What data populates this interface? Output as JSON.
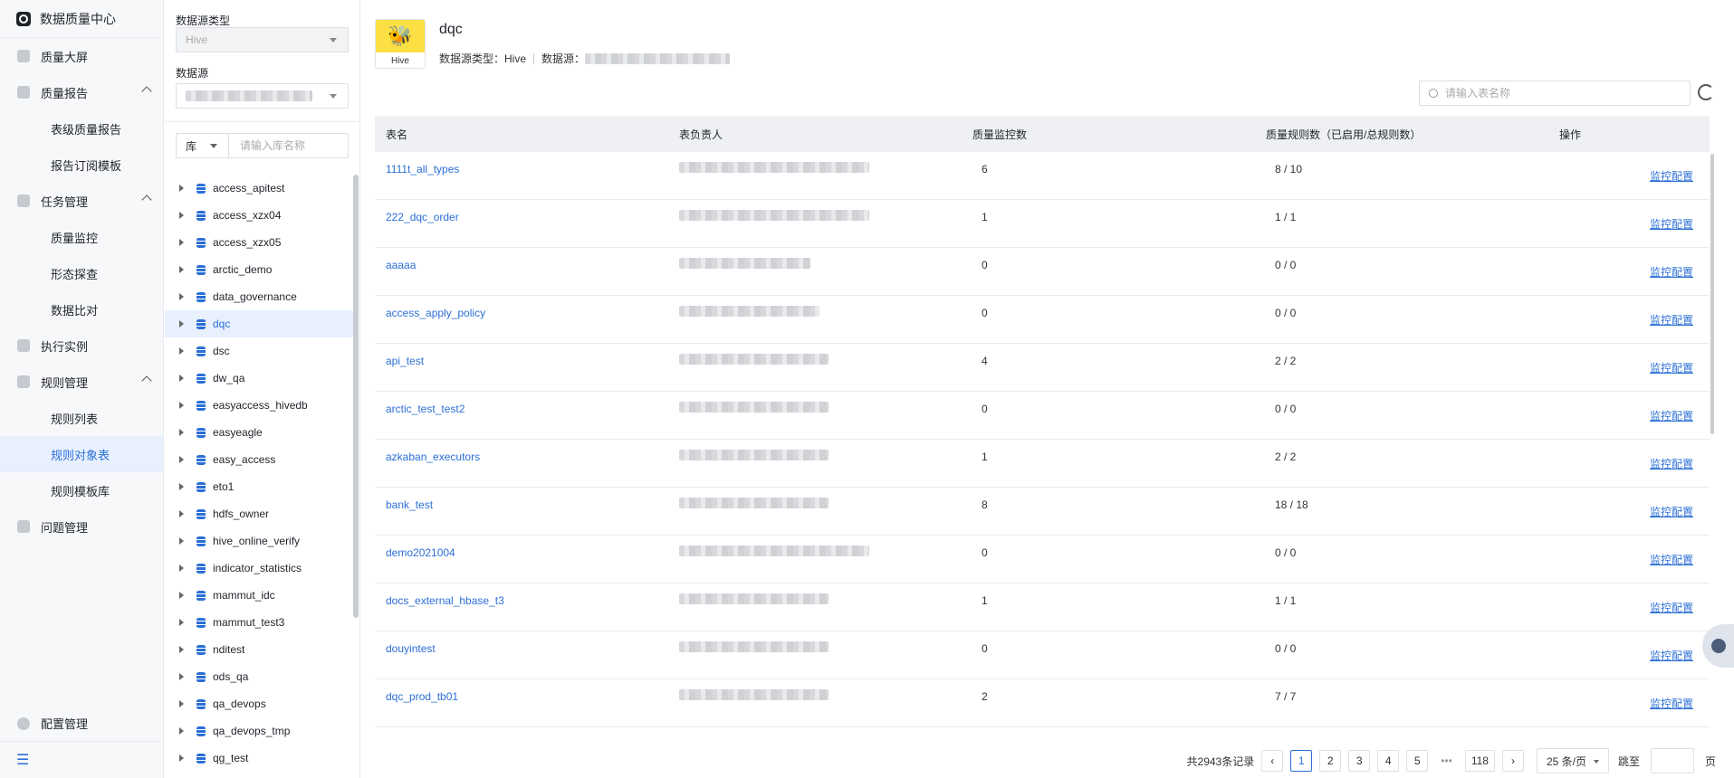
{
  "nav": {
    "title": "数据质量中心",
    "items": [
      {
        "label": "质量大屏",
        "icon": "dashboard-icon"
      },
      {
        "label": "质量报告",
        "icon": "report-icon",
        "expanded": true,
        "children": [
          {
            "label": "表级质量报告"
          },
          {
            "label": "报告订阅模板"
          }
        ]
      },
      {
        "label": "任务管理",
        "icon": "task-icon",
        "expanded": true,
        "children": [
          {
            "label": "质量监控"
          },
          {
            "label": "形态探查"
          },
          {
            "label": "数据比对"
          }
        ]
      },
      {
        "label": "执行实例",
        "icon": "instance-icon"
      },
      {
        "label": "规则管理",
        "icon": "rule-icon",
        "expanded": true,
        "children": [
          {
            "label": "规则列表"
          },
          {
            "label": "规则对象表",
            "active": true
          },
          {
            "label": "规则模板库"
          }
        ]
      },
      {
        "label": "问题管理",
        "icon": "issue-icon"
      }
    ],
    "config": "配置管理"
  },
  "tree": {
    "type_label": "数据源类型",
    "type_value": "Hive",
    "source_label": "数据源",
    "kind": "库",
    "search_placeholder": "请输入库名称",
    "databases": [
      "access_apitest",
      "access_xzx04",
      "access_xzx05",
      "arctic_demo",
      "data_governance",
      "dqc",
      "dsc",
      "dw_qa",
      "easyaccess_hivedb",
      "easyeagle",
      "easy_access",
      "eto1",
      "hdfs_owner",
      "hive_online_verify",
      "indicator_statistics",
      "mammut_idc",
      "mammut_test3",
      "nditest",
      "ods_qa",
      "qa_devops",
      "qa_devops_tmp",
      "qg_test"
    ],
    "active": "dqc"
  },
  "main": {
    "logo_text": "Hive",
    "name": "dqc",
    "type_label": "数据源类型：",
    "type_value": "Hive",
    "source_label": "数据源：",
    "search_placeholder": "请输入表名称",
    "columns": [
      "表名",
      "表负责人",
      "质量监控数",
      "质量规则数（已启用/总规则数）",
      "操作"
    ],
    "rows": [
      {
        "name": "1111t_all_types",
        "monitors": "6",
        "rules": "8 / 10",
        "action": "监控配置"
      },
      {
        "name": "222_dqc_order",
        "monitors": "1",
        "rules": "1 / 1",
        "action": "监控配置"
      },
      {
        "name": "aaaaa",
        "monitors": "0",
        "rules": "0 / 0",
        "action": "监控配置"
      },
      {
        "name": "access_apply_policy",
        "monitors": "0",
        "rules": "0 / 0",
        "action": "监控配置"
      },
      {
        "name": "api_test",
        "monitors": "4",
        "rules": "2 / 2",
        "action": "监控配置"
      },
      {
        "name": "arctic_test_test2",
        "monitors": "0",
        "rules": "0 / 0",
        "action": "监控配置"
      },
      {
        "name": "azkaban_executors",
        "monitors": "1",
        "rules": "2 / 2",
        "action": "监控配置"
      },
      {
        "name": "bank_test",
        "monitors": "8",
        "rules": "18 / 18",
        "action": "监控配置"
      },
      {
        "name": "demo2021004",
        "monitors": "0",
        "rules": "0 / 0",
        "action": "监控配置"
      },
      {
        "name": "docs_external_hbase_t3",
        "monitors": "1",
        "rules": "1 / 1",
        "action": "监控配置"
      },
      {
        "name": "douyintest",
        "monitors": "0",
        "rules": "0 / 0",
        "action": "监控配置"
      },
      {
        "name": "dqc_prod_tb01",
        "monitors": "2",
        "rules": "7 / 7",
        "action": "监控配置"
      }
    ],
    "pager": {
      "total": "共2943条记录",
      "pages": [
        "1",
        "2",
        "3",
        "4",
        "5"
      ],
      "ellipsis": "•••",
      "last": "118",
      "size": "25 条/页",
      "jump_label": "跳至",
      "page_unit": "页"
    }
  }
}
